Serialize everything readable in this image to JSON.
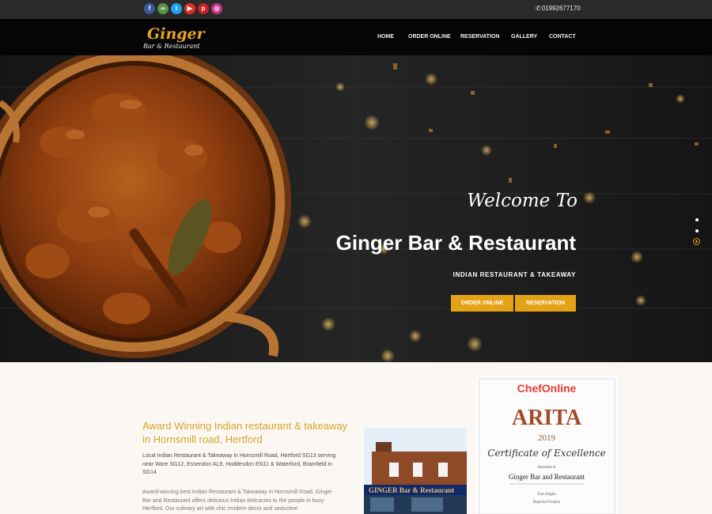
{
  "social": [
    {
      "name": "facebook-icon",
      "glyph": "f",
      "color": "#3b5998"
    },
    {
      "name": "tripadvisor-icon",
      "glyph": "∞",
      "color": "#589442"
    },
    {
      "name": "twitter-icon",
      "glyph": "t",
      "color": "#1da1f2"
    },
    {
      "name": "youtube-icon",
      "glyph": "▶",
      "color": "#e52d27"
    },
    {
      "name": "pinterest-icon",
      "glyph": "p",
      "color": "#cb2027"
    },
    {
      "name": "instagram-icon",
      "glyph": "◎",
      "color": "#c13584"
    }
  ],
  "phone": {
    "number": "01992677170",
    "icon": "phone-icon"
  },
  "brand": {
    "name": "Ginger",
    "sub": "Bar & Restaurant"
  },
  "nav": [
    "HOME",
    "ORDER ONLINE",
    "RESERVATION",
    "GALLERY",
    "CONTACT"
  ],
  "hero": {
    "welcome": "Welcome To",
    "title": "Ginger Bar & Restaurant",
    "subtitle": "INDIAN RESTAURANT & TAKEAWAY",
    "btn_order": "ORDER ONLINE",
    "btn_reservation": "RESERVATION",
    "slide_count": 3,
    "active_slide": 3
  },
  "about": {
    "title": "Award Winning Indian restaurant & takeaway in Hornsmill road, Hertford",
    "text1": "Local Indian Restaurant & Takeaway in Hornsmill Road, Hertford SG13 serving near Ware SG12, Essendon AL9, Hoddesdon EN11 & Waterford, Bramfield in SG14",
    "text2": "Award-winning best Indian Restaurant & Takeaway in Hornsmill Road, Ginger Bar and Restaurant offers delicious Indian delicacies to the people in busy Hertford. Our culinary art with chic modern decor and seductive"
  },
  "shop_sign": "GINGER Bar & Restaurant",
  "certificate": {
    "brand": "ChefOnline",
    "award": "ARITA",
    "year": "2019",
    "heading": "Certificate of Excellence",
    "awarded": "Awarded to",
    "recipient": "Ginger Bar and Restaurant",
    "region": "East Anglia",
    "result": "Regional Finalist"
  },
  "colors": {
    "accent": "#e4a316",
    "heading": "#d8a326",
    "topbar": "#2a2a2a",
    "nav_bg": "#050505"
  }
}
